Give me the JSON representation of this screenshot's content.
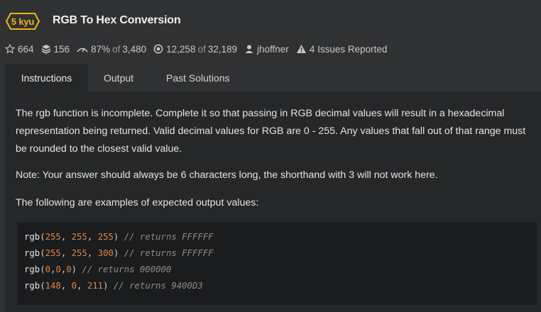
{
  "kata": {
    "rank": "5 kyu",
    "title": "RGB To Hex Conversion",
    "rank_color": "#ecb613"
  },
  "stats": {
    "stars": "664",
    "collections": "156",
    "satisfaction": "87%",
    "satisfaction_of": "of",
    "satisfaction_total": "3,480",
    "completed": "12,258",
    "completed_of": "of",
    "completed_total": "32,189",
    "author": "jhoffner",
    "issues": "4 Issues Reported"
  },
  "tabs": [
    {
      "label": "Instructions",
      "active": true
    },
    {
      "label": "Output",
      "active": false
    },
    {
      "label": "Past Solutions",
      "active": false
    }
  ],
  "instructions": {
    "paragraph1": "The rgb function is incomplete. Complete it so that passing in RGB decimal values will result in a hexadecimal representation being returned. Valid decimal values for RGB are 0 - 255. Any values that fall out of that range must be rounded to the closest valid value.",
    "paragraph2": "Note: Your answer should always be 6 characters long, the shorthand with 3 will not work here.",
    "paragraph3": "The following are examples of expected output values:"
  },
  "code_examples": [
    {
      "fn": "rgb",
      "args": [
        "255",
        "255",
        "255"
      ],
      "sep": ", ",
      "comment": "// returns FFFFFF"
    },
    {
      "fn": "rgb",
      "args": [
        "255",
        "255",
        "300"
      ],
      "sep": ", ",
      "comment": "// returns FFFFFF"
    },
    {
      "fn": "rgb",
      "args": [
        "0",
        "0",
        "0"
      ],
      "sep": ",",
      "comment": "// returns 000000"
    },
    {
      "fn": "rgb",
      "args": [
        "148",
        "0",
        "211"
      ],
      "sep": ", ",
      "comment": "// returns 9400D3"
    }
  ],
  "colors": {
    "background": "#303133",
    "panel": "#262729",
    "code_background": "#1b1c1e",
    "number": "#de8540",
    "comment": "#8c8c8c"
  },
  "icons": {
    "stars": "star-icon",
    "collections": "stack-icon",
    "satisfaction": "thumbs-up-icon",
    "completed": "target-icon",
    "author": "user-icon",
    "issues": "warning-icon"
  }
}
